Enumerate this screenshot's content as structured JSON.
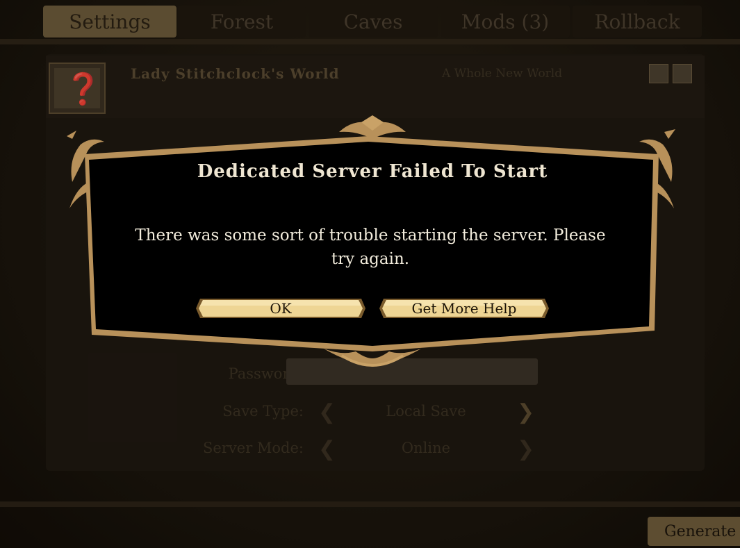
{
  "tabs": [
    {
      "label": "Settings",
      "active": true
    },
    {
      "label": "Forest",
      "active": false
    },
    {
      "label": "Caves",
      "active": false
    },
    {
      "label": "Mods (3)",
      "active": false
    },
    {
      "label": "Rollback",
      "active": false
    }
  ],
  "world": {
    "name": "Lady Stitchclock's World",
    "subtitle": "A Whole New World"
  },
  "form": {
    "password_label": "Password:",
    "save_type_label": "Save Type:",
    "save_type_value": "Local Save",
    "server_mode_label": "Server Mode:",
    "server_mode_value": "Online"
  },
  "footer": {
    "generate_label": "Generate W"
  },
  "dialog": {
    "title": "Dedicated Server Failed To Start",
    "message": "There was some sort of trouble starting the server. Please try again.",
    "ok_label": "OK",
    "help_label": "Get More Help"
  },
  "colors": {
    "gold": "#e9cf8c",
    "frame": "#b8915a",
    "dialog_bg": "#000000"
  }
}
